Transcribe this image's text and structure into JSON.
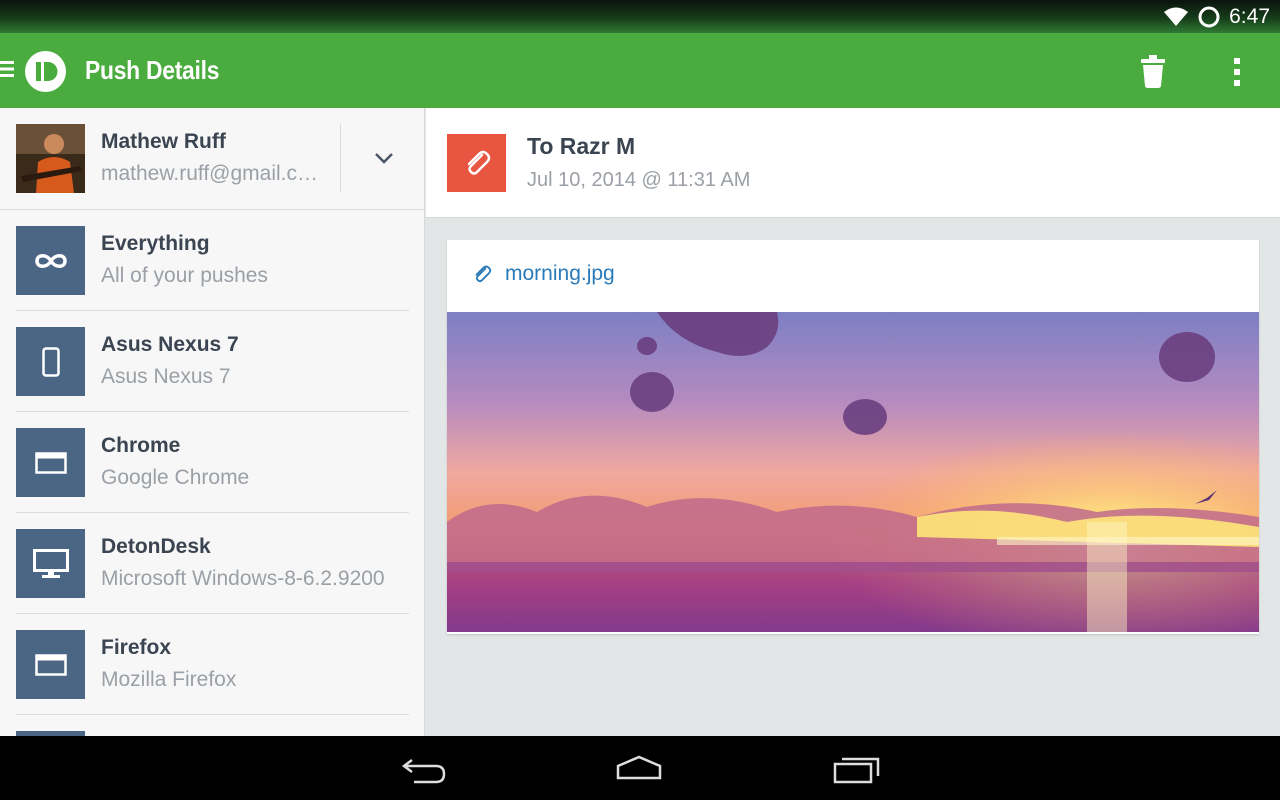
{
  "status_bar": {
    "time": "6:47",
    "wifi_icon": "wifi-icon",
    "sync_icon": "sync-ring-icon"
  },
  "action_bar": {
    "title": "Push Details",
    "menu_icon": "hamburger-icon",
    "logo_icon": "pushbullet-logo",
    "delete_icon": "trash-icon",
    "overflow_icon": "overflow-menu-icon",
    "color": "#4aab3e"
  },
  "account": {
    "name": "Mathew Ruff",
    "email": "mathew.ruff@gmail.com",
    "dropdown_icon": "chevron-down-icon"
  },
  "devices": [
    {
      "name": "Everything",
      "subtitle": "All of your pushes",
      "icon": "infinity-icon"
    },
    {
      "name": "Asus Nexus 7",
      "subtitle": "Asus Nexus 7",
      "icon": "phone-icon"
    },
    {
      "name": "Chrome",
      "subtitle": "Google Chrome",
      "icon": "browser-window-icon"
    },
    {
      "name": "DetonDesk",
      "subtitle": "Microsoft Windows-8-6.2.9200",
      "icon": "desktop-monitor-icon"
    },
    {
      "name": "Firefox",
      "subtitle": "Mozilla Firefox",
      "icon": "browser-window-icon"
    }
  ],
  "push": {
    "title": "To Razr M",
    "date": "Jul 10, 2014 @ 11:31 AM",
    "type_icon": "paperclip-icon",
    "type_color": "#e85642"
  },
  "file": {
    "name": "morning.jpg",
    "icon": "paperclip-icon"
  },
  "nav_bar": {
    "back_icon": "back-icon",
    "home_icon": "home-icon",
    "recents_icon": "recents-icon"
  }
}
